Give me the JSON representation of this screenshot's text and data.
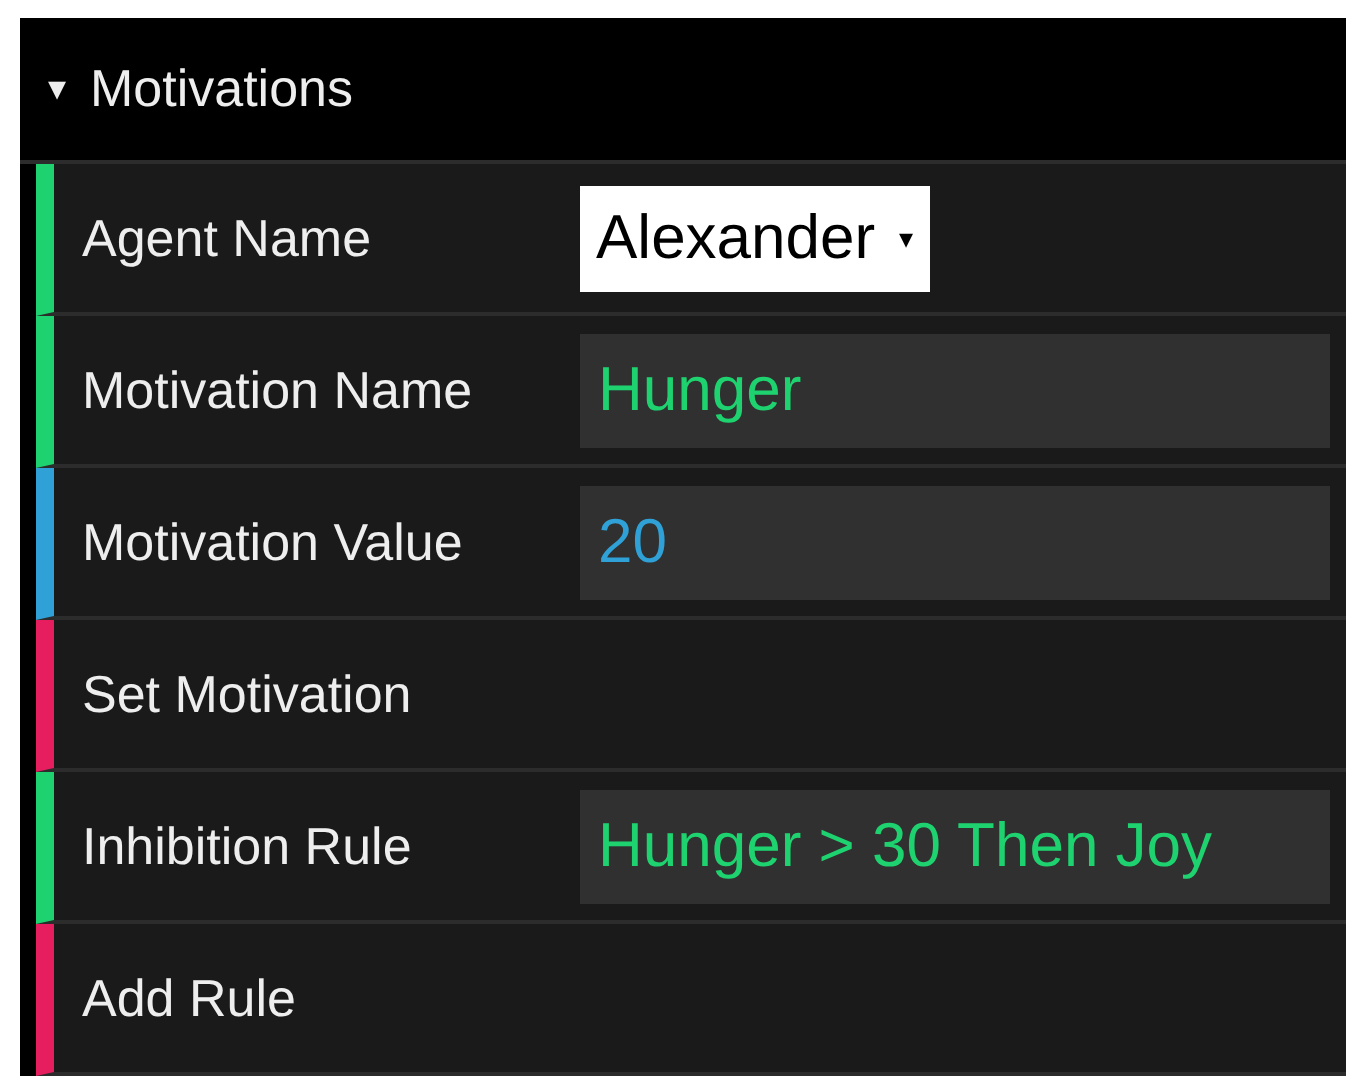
{
  "folder": {
    "title": "Motivations",
    "caret": "▾",
    "expanded": true
  },
  "controllers": [
    {
      "kind": "select",
      "label": "Agent Name",
      "value": "Alexander",
      "caret": "▾"
    },
    {
      "kind": "string",
      "label": "Motivation Name",
      "value": "Hunger"
    },
    {
      "kind": "number",
      "label": "Motivation Value",
      "value": "20"
    },
    {
      "kind": "function",
      "label": "Set Motivation"
    },
    {
      "kind": "string",
      "label": "Inhibition Rule",
      "value": "Hunger > 30 Then Joy"
    },
    {
      "kind": "function",
      "label": "Add Rule"
    }
  ]
}
